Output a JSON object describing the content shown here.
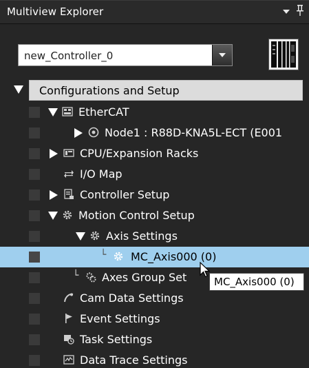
{
  "panel": {
    "title": "Multiview Explorer",
    "title_icons": [
      "dropdown-arrow-icon",
      "pin-icon"
    ]
  },
  "controller": {
    "selected": "new_Controller_0",
    "icon": "controller-device-icon"
  },
  "tree": {
    "root_label": "Configurations and Setup",
    "items": [
      {
        "label": "EtherCAT",
        "icon": "ethercat-icon",
        "expanded": true
      },
      {
        "label": "Node1 : R88D-KNA5L-ECT (E001",
        "icon": "node-icon",
        "expanded": false
      },
      {
        "label": "CPU/Expansion Racks",
        "icon": "rack-icon",
        "expanded": false
      },
      {
        "label": "I/O Map",
        "icon": "io-map-icon"
      },
      {
        "label": "Controller Setup",
        "icon": "controller-setup-icon",
        "expanded": false
      },
      {
        "label": "Motion Control Setup",
        "icon": "motion-gear-icon",
        "expanded": true
      },
      {
        "label": "Axis Settings",
        "icon": "axis-gear-icon",
        "expanded": true
      },
      {
        "label": "MC_Axis000 (0)",
        "icon": "axis-item-icon",
        "selected": true
      },
      {
        "label": "Axes Group Set",
        "icon": "axes-group-icon"
      },
      {
        "label": "Cam Data Settings",
        "icon": "cam-icon"
      },
      {
        "label": "Event Settings",
        "icon": "flag-icon"
      },
      {
        "label": "Task Settings",
        "icon": "task-icon"
      },
      {
        "label": "Data Trace Settings",
        "icon": "trace-icon"
      }
    ]
  },
  "tooltip": {
    "text": "MC_Axis000 (0)"
  },
  "colors": {
    "background": "#262626",
    "selection": "#9fcfee",
    "root_header": "#dcdcdc"
  }
}
